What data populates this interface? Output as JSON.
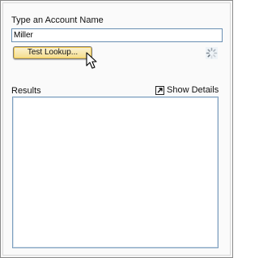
{
  "form": {
    "prompt_label": "Type an Account Name",
    "account_name_value": "Miller",
    "lookup_button_label": "Test Lookup..."
  },
  "results": {
    "label": "Results",
    "show_details_label": "Show Details",
    "items": []
  },
  "icons": {
    "details": "external-link-icon",
    "spinner": "loading-spinner-icon",
    "cursor": "mouse-pointer-icon"
  },
  "colors": {
    "button_fill": "#f4dc8a",
    "button_focus_border": "#f2c94c",
    "input_border": "#6a8fb3"
  }
}
